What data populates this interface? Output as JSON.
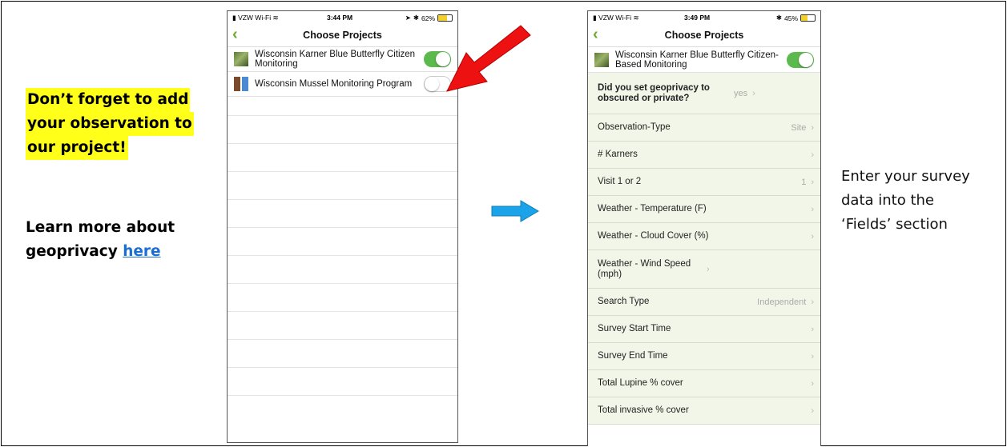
{
  "left_panel": {
    "reminder_lines": [
      "Don’t forget to add",
      "your observation to",
      "our project!"
    ],
    "learn_more_text": "Learn more about",
    "learn_more_prefix": "geoprivacy ",
    "learn_more_link": "here"
  },
  "right_panel": {
    "lines": [
      "Enter your survey",
      "data into the",
      "‘Fields’ section"
    ]
  },
  "phone1": {
    "status": {
      "carrier": "VZW Wi-Fi",
      "time": "3:44 PM",
      "battery": "62%",
      "battery_level": 0.62
    },
    "nav_title": "Choose Projects",
    "projects": [
      {
        "name": "Wisconsin Karner Blue Butterfly Citizen Monitoring",
        "enabled": true
      },
      {
        "name": "Wisconsin Mussel Monitoring Program",
        "enabled": false
      }
    ]
  },
  "phone2": {
    "status": {
      "carrier": "VZW Wi-Fi",
      "time": "3:49 PM",
      "battery": "45%",
      "battery_level": 0.45
    },
    "nav_title": "Choose Projects",
    "project": {
      "name": "Wisconsin Karner Blue Butterfly Citizen-Based Monitoring",
      "enabled": true
    },
    "fields": [
      {
        "label": "Did you set geoprivacy to obscured or private?",
        "value": "yes"
      },
      {
        "label": "Observation-Type",
        "value": "Site"
      },
      {
        "label": "# Karners",
        "value": ""
      },
      {
        "label": "Visit 1 or 2",
        "value": "1"
      },
      {
        "label": "Weather - Temperature (F)",
        "value": ""
      },
      {
        "label": "Weather - Cloud Cover (%)",
        "value": ""
      },
      {
        "label": "Weather - Wind Speed (mph)",
        "value": ""
      },
      {
        "label": "Search Type",
        "value": "Independent"
      },
      {
        "label": "Survey Start Time",
        "value": ""
      },
      {
        "label": "Survey End Time",
        "value": ""
      },
      {
        "label": "Total Lupine % cover",
        "value": ""
      },
      {
        "label": "Total invasive % cover",
        "value": ""
      }
    ]
  },
  "colors": {
    "highlight": "#ffff1a",
    "link": "#1a6fd1",
    "toggle_on": "#5cb94d",
    "red_arrow": "#ee1111",
    "blue_arrow": "#1aa3e8",
    "field_bg": "#f2f6e8"
  },
  "icons": {
    "back": "chevron-left-icon",
    "chevron": "chevron-right-icon"
  }
}
